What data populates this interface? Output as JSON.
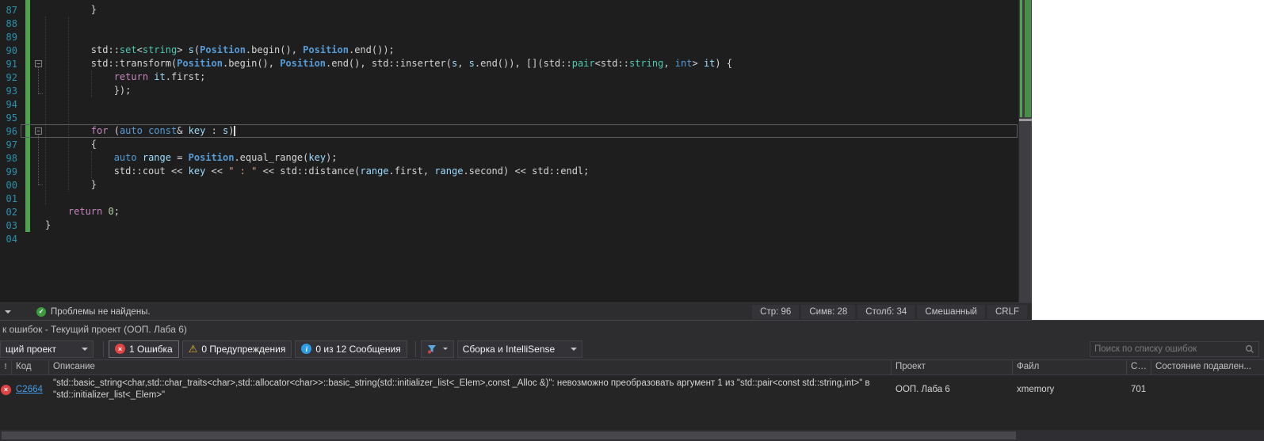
{
  "editor": {
    "lines": [
      {
        "num": "87",
        "indent": 8,
        "toks": [
          [
            "t",
            "}"
          ]
        ]
      },
      {
        "num": "88",
        "indent": 0,
        "toks": []
      },
      {
        "num": "89",
        "indent": 0,
        "toks": []
      },
      {
        "num": "90",
        "indent": 8,
        "toks": [
          [
            "t",
            "std::"
          ],
          [
            "y",
            "set"
          ],
          [
            "t",
            "<"
          ],
          [
            "y",
            "string"
          ],
          [
            "t",
            "> "
          ],
          [
            "v",
            "s"
          ],
          [
            "t",
            "("
          ],
          [
            "g",
            "Position"
          ],
          [
            "t",
            ".begin(), "
          ],
          [
            "g",
            "Position"
          ],
          [
            "t",
            ".end());"
          ]
        ]
      },
      {
        "num": "91",
        "indent": 8,
        "fold": true,
        "toks": [
          [
            "t",
            "std::transform("
          ],
          [
            "g",
            "Position"
          ],
          [
            "t",
            ".begin(), "
          ],
          [
            "g",
            "Position"
          ],
          [
            "t",
            ".end(), std::inserter("
          ],
          [
            "v",
            "s"
          ],
          [
            "t",
            ", "
          ],
          [
            "v",
            "s"
          ],
          [
            "t",
            ".end()), [](std::"
          ],
          [
            "y",
            "pair"
          ],
          [
            "t",
            "<std::"
          ],
          [
            "y",
            "string"
          ],
          [
            "t",
            ", "
          ],
          [
            "k",
            "int"
          ],
          [
            "t",
            "> "
          ],
          [
            "v",
            "it"
          ],
          [
            "t",
            ") {"
          ]
        ]
      },
      {
        "num": "92",
        "indent": 12,
        "toks": [
          [
            "c",
            "return"
          ],
          [
            "t",
            " "
          ],
          [
            "v",
            "it"
          ],
          [
            "t",
            ".first;"
          ]
        ]
      },
      {
        "num": "93",
        "indent": 12,
        "toks": [
          [
            "t",
            "});"
          ]
        ]
      },
      {
        "num": "94",
        "indent": 0,
        "toks": []
      },
      {
        "num": "95",
        "indent": 0,
        "toks": []
      },
      {
        "num": "96",
        "indent": 8,
        "fold": true,
        "current": true,
        "toks": [
          [
            "c",
            "for"
          ],
          [
            "t",
            " ("
          ],
          [
            "k",
            "auto"
          ],
          [
            "t",
            " "
          ],
          [
            "k",
            "const"
          ],
          [
            "t",
            "& "
          ],
          [
            "v",
            "key"
          ],
          [
            "t",
            " : "
          ],
          [
            "v",
            "s"
          ],
          [
            "t",
            ")"
          ]
        ]
      },
      {
        "num": "97",
        "indent": 8,
        "toks": [
          [
            "t",
            "{"
          ]
        ]
      },
      {
        "num": "98",
        "indent": 12,
        "toks": [
          [
            "k",
            "auto"
          ],
          [
            "t",
            " "
          ],
          [
            "v",
            "range"
          ],
          [
            "t",
            " = "
          ],
          [
            "g",
            "Position"
          ],
          [
            "t",
            ".equal_range("
          ],
          [
            "v",
            "key"
          ],
          [
            "t",
            ");"
          ]
        ]
      },
      {
        "num": "99",
        "indent": 12,
        "toks": [
          [
            "t",
            "std::cout << "
          ],
          [
            "v",
            "key"
          ],
          [
            "t",
            " << "
          ],
          [
            "s",
            "\" : \""
          ],
          [
            "t",
            " << std::distance("
          ],
          [
            "v",
            "range"
          ],
          [
            "t",
            ".first, "
          ],
          [
            "v",
            "range"
          ],
          [
            "t",
            ".second) << std::endl;"
          ]
        ]
      },
      {
        "num": "00",
        "indent": 8,
        "toks": [
          [
            "t",
            "}"
          ]
        ]
      },
      {
        "num": "01",
        "indent": 0,
        "toks": []
      },
      {
        "num": "02",
        "indent": 4,
        "toks": [
          [
            "c",
            "return"
          ],
          [
            "t",
            " "
          ],
          [
            "n",
            "0"
          ],
          [
            "t",
            ";"
          ]
        ]
      },
      {
        "num": "03",
        "indent": 0,
        "toks": [
          [
            "t",
            "}"
          ]
        ]
      },
      {
        "num": "04",
        "indent": 0,
        "toks": []
      }
    ]
  },
  "status_bar": {
    "health": "Проблемы не найдены.",
    "line": "Стр: 96",
    "char_pos": "Симв: 28",
    "col": "Столб: 34",
    "encoding": "Смешанный",
    "line_ending": "CRLF"
  },
  "error_list": {
    "title": "к ошибок - Текущий проект (ООП. Лаба 6)",
    "scope_filter": "щий проект",
    "errors_button": "1 Ошибка",
    "warnings_button": "0 Предупреждения",
    "messages_button": "0 из 12 Сообщения",
    "source_filter": "Сборка и IntelliSense",
    "search_placeholder": "Поиск по списку ошибок",
    "columns": {
      "severity_glyph": "!",
      "code": "Код",
      "description": "Описание",
      "project": "Проект",
      "file": "Файл",
      "line": "Ст...",
      "suppression": "Состояние подавлен..."
    },
    "rows": [
      {
        "code": "C2664",
        "description": "\"std::basic_string<char,std::char_traits<char>,std::allocator<char>>::basic_string(std::initializer_list<_Elem>,const _Alloc &)\": невозможно преобразовать аргумент 1 из \"std::pair<const std::string,int>\" в \"std::initializer_list<_Elem>\"",
        "project": "ООП. Лаба 6",
        "file": "xmemory",
        "line": "701",
        "suppression": ""
      }
    ]
  },
  "icons": {
    "error": "×",
    "warning": "⚠",
    "info": "i",
    "health": "✓"
  },
  "colors": {
    "error_red": "#e04343",
    "warning_yellow": "#e9b32b",
    "info_blue": "#2d9de5",
    "success_green": "#3c9b3c",
    "change_track_green": "#4ea34e",
    "error_code_link_blue": "#459ce8",
    "line_number_blue": "#2b91af"
  }
}
